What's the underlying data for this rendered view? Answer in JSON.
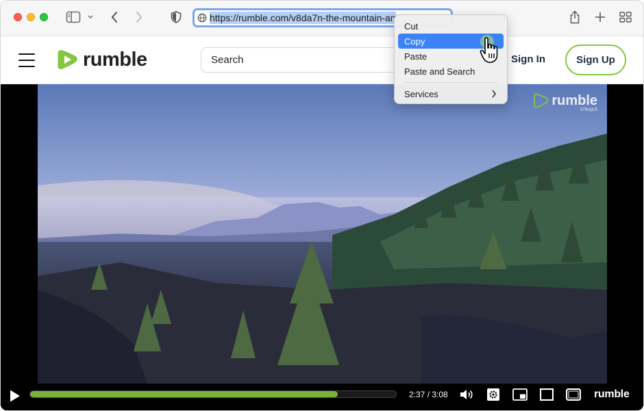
{
  "browser": {
    "url": "https://rumble.com/v8da7n-the-mountain-an",
    "icons": [
      "sidebar-icon",
      "chevron-down-icon",
      "back-icon",
      "forward-icon",
      "shield-icon",
      "globe-icon",
      "share-icon",
      "plus-icon",
      "grid-icon"
    ]
  },
  "site": {
    "logo_text": "rumble",
    "search_placeholder": "Search",
    "sign_in": "Sign In",
    "sign_up": "Sign Up",
    "accent": "#85c742"
  },
  "video": {
    "watermark": "rumble",
    "watermark_credit": "©TerjeS",
    "time": "2:37 / 3:08",
    "progress": 0.84,
    "controls_logo": "rumble"
  },
  "context_menu": {
    "items": [
      {
        "label": "Cut"
      },
      {
        "label": "Copy"
      },
      {
        "label": "Paste"
      },
      {
        "label": "Paste and Search"
      },
      {
        "label": "Services"
      }
    ],
    "active_index": 1
  }
}
